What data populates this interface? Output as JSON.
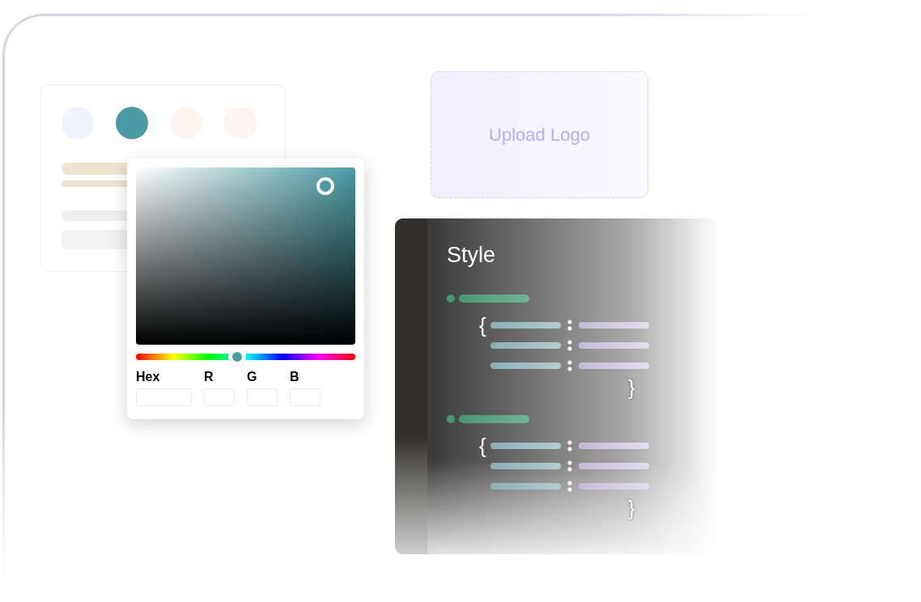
{
  "palette_card": {
    "swatches": [
      {
        "color": "#f2f2fe"
      },
      {
        "color": "#4a9ba5"
      },
      {
        "color": "#fff5ef"
      },
      {
        "color": "#fff3ef"
      }
    ]
  },
  "color_picker": {
    "hue_slider": {
      "level": 0.46
    },
    "fields": [
      {
        "label": "Hex",
        "kind": "wide"
      },
      {
        "label": "R",
        "kind": "narrow"
      },
      {
        "label": "G",
        "kind": "narrow"
      },
      {
        "label": "B",
        "kind": "narrow"
      }
    ]
  },
  "upload_logo": {
    "label": "Upload Logo"
  },
  "style_panel": {
    "title": "Style",
    "rules": [
      {
        "open": "{",
        "close": "}"
      },
      {
        "open": "{",
        "close": "}"
      }
    ]
  }
}
